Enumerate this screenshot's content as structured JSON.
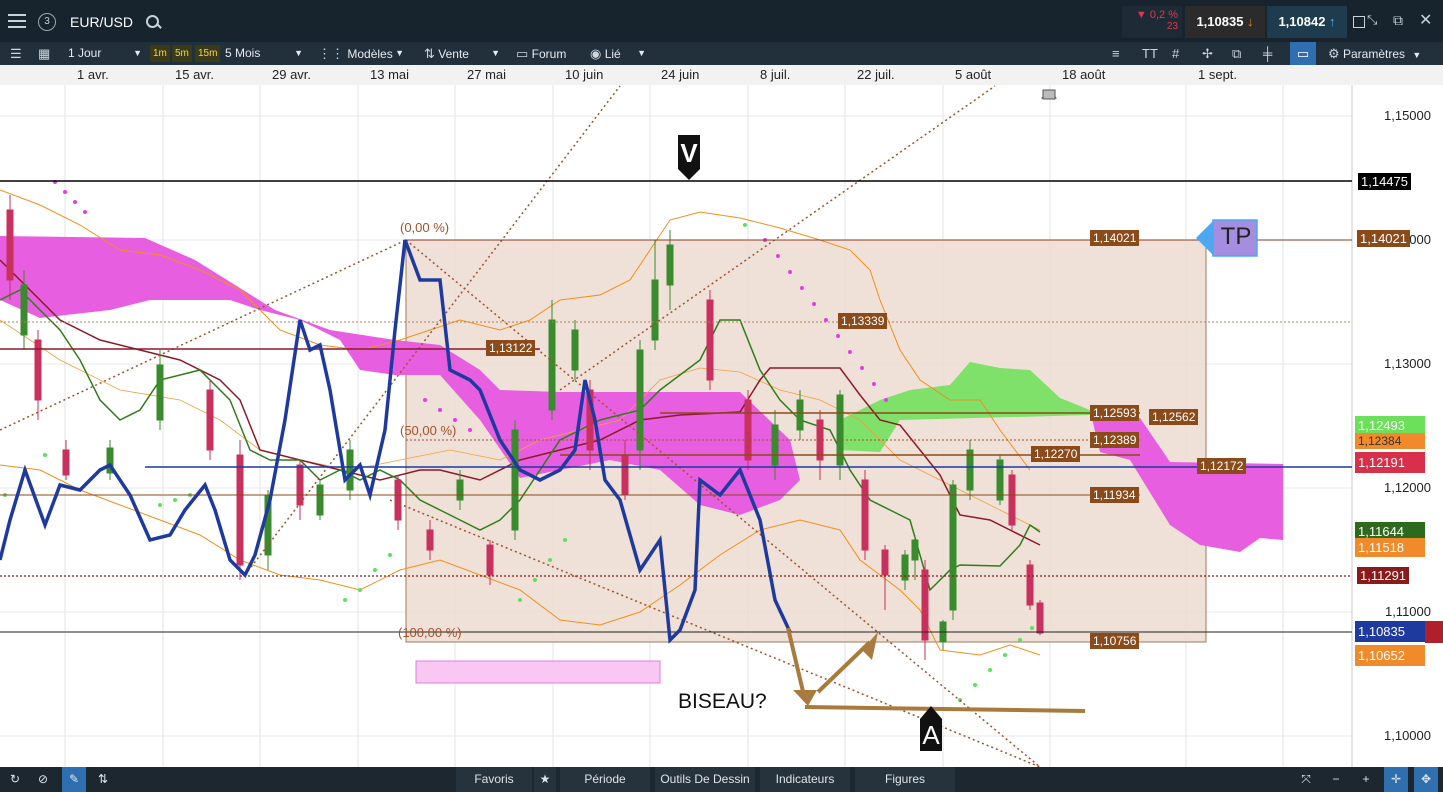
{
  "header": {
    "tab_number": "3",
    "symbol": "EUR/USD",
    "change_pct": "▼ 0,2 %",
    "change_count": "23",
    "sell_price": "1,10835",
    "buy_price": "1,10842"
  },
  "toolbar": {
    "timeframe": "1 Jour",
    "quick_intervals": [
      "1m",
      "5m",
      "15m"
    ],
    "range": "5 Mois",
    "templates": "Modèles",
    "order": "Vente",
    "forum": "Forum",
    "linked": "Lié",
    "settings": "Paramètres"
  },
  "date_axis": [
    "1 avr.",
    "15 avr.",
    "29 avr.",
    "13 mai",
    "27 mai",
    "10 juin",
    "24 juin",
    "8 juil.",
    "22 juil.",
    "5 août",
    "18 août",
    "1 sept."
  ],
  "price_axis": [
    "1,15000",
    "1,14000",
    "1,13000",
    "1,12000",
    "1,11000",
    "1,10000"
  ],
  "price_badges": {
    "b1": "1,14475",
    "b2": "1,14021",
    "b3": "1,12493",
    "b4": "1,12384",
    "b5": "1,12191",
    "b6": "1,11644",
    "b7": "1,11518",
    "b8": "1,11291",
    "b9": "1,10835",
    "b10": "1,10652"
  },
  "chart_labels": {
    "l_14021": "1,14021",
    "l_13339": "1,13339",
    "l_13122": "1,13122",
    "l_12593": "1,12593",
    "l_12562": "1,12562",
    "l_12389": "1,12389",
    "l_12270": "1,12270",
    "l_12172": "1,12172",
    "l_11934": "1,11934",
    "l_10756": "1,10756"
  },
  "fib": {
    "f0": "(0,00 %)",
    "f50": "(50,00 %)",
    "f100": "(100,00 %)"
  },
  "annotations": {
    "v": "V",
    "a": "A",
    "tp": "TP",
    "wedge": "BISEAU?"
  },
  "bottom": {
    "favorites": "Favoris",
    "period": "Période",
    "drawing_tools": "Outils De Dessin",
    "indicators": "Indicateurs",
    "figures": "Figures"
  },
  "colors": {
    "candle_up": "#3a8a2e",
    "candle_down": "#c8305e",
    "cloud_bear": "#e85ee0",
    "cloud_bull": "#7fe06a",
    "macd_line": "#1f3a9e",
    "fib_zone": "#ecdcd0",
    "brown": "#8b5a2b"
  }
}
